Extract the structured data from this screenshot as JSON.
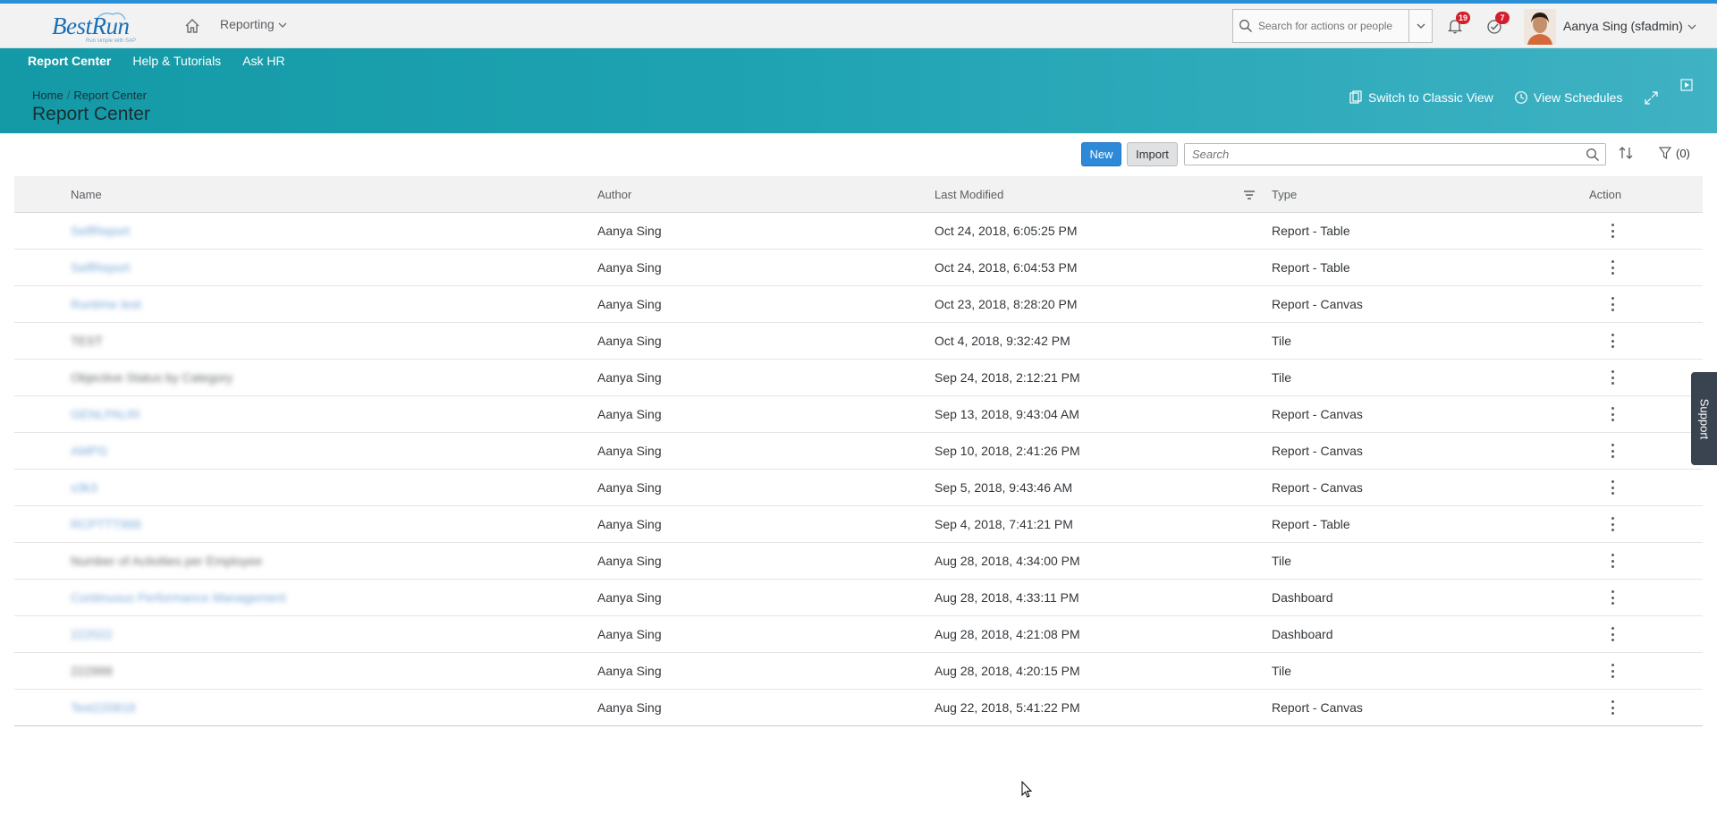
{
  "shell": {
    "logo_text": "BestRun",
    "logo_sub": "Run simple with SAP",
    "menu_label": "Reporting",
    "search_placeholder": "Search for actions or people",
    "notifications_count": "19",
    "todo_count": "7",
    "user_name": "Aanya Sing (sfadmin)"
  },
  "subnav": {
    "items": [
      {
        "label": "Report Center"
      },
      {
        "label": "Help & Tutorials"
      },
      {
        "label": "Ask HR"
      }
    ]
  },
  "breadcrumb": {
    "home": "Home",
    "current": "Report Center"
  },
  "page": {
    "title": "Report Center",
    "switch_label": "Switch to Classic View",
    "schedules_label": "View Schedules"
  },
  "toolbar": {
    "new_label": "New",
    "import_label": "Import",
    "search_placeholder": "Search",
    "filter_count": "(0)"
  },
  "table": {
    "columns": {
      "name": "Name",
      "author": "Author",
      "modified": "Last Modified",
      "type": "Type",
      "action": "Action"
    },
    "rows": [
      {
        "name": "SelfReport",
        "author": "Aanya Sing",
        "modified": "Oct 24, 2018, 6:05:25 PM",
        "type": "Report - Table"
      },
      {
        "name": "SelfReport",
        "author": "Aanya Sing",
        "modified": "Oct 24, 2018, 6:04:53 PM",
        "type": "Report - Table"
      },
      {
        "name": "Runtime test",
        "author": "Aanya Sing",
        "modified": "Oct 23, 2018, 8:28:20 PM",
        "type": "Report - Canvas"
      },
      {
        "name": "TEST",
        "author": "Aanya Sing",
        "modified": "Oct 4, 2018, 9:32:42 PM",
        "type": "Tile"
      },
      {
        "name": "Objective Status by Category",
        "author": "Aanya Sing",
        "modified": "Sep 24, 2018, 2:12:21 PM",
        "type": "Tile"
      },
      {
        "name": "GENLPALRI",
        "author": "Aanya Sing",
        "modified": "Sep 13, 2018, 9:43:04 AM",
        "type": "Report - Canvas"
      },
      {
        "name": "AMPG",
        "author": "Aanya Sing",
        "modified": "Sep 10, 2018, 2:41:26 PM",
        "type": "Report - Canvas"
      },
      {
        "name": "s3k3",
        "author": "Aanya Sing",
        "modified": "Sep 5, 2018, 9:43:46 AM",
        "type": "Report - Canvas"
      },
      {
        "name": "RCPTTT999",
        "author": "Aanya Sing",
        "modified": "Sep 4, 2018, 7:41:21 PM",
        "type": "Report - Table"
      },
      {
        "name": "Number of Activities per Employee",
        "author": "Aanya Sing",
        "modified": "Aug 28, 2018, 4:34:00 PM",
        "type": "Tile"
      },
      {
        "name": "Continuous Performance Management",
        "author": "Aanya Sing",
        "modified": "Aug 28, 2018, 4:33:11 PM",
        "type": "Dashboard"
      },
      {
        "name": "222022",
        "author": "Aanya Sing",
        "modified": "Aug 28, 2018, 4:21:08 PM",
        "type": "Dashboard"
      },
      {
        "name": "222999",
        "author": "Aanya Sing",
        "modified": "Aug 28, 2018, 4:20:15 PM",
        "type": "Tile"
      },
      {
        "name": "Test220818",
        "author": "Aanya Sing",
        "modified": "Aug 22, 2018, 5:41:22 PM",
        "type": "Report - Canvas"
      }
    ]
  },
  "support": {
    "label": "Support"
  },
  "colors": {
    "accent": "#2b8fd6",
    "hero": "#1fa3b3",
    "primary_button": "#2e8ad8",
    "badge": "#d21f2b"
  },
  "icons": [
    "home-icon",
    "chevron-down-icon",
    "search-icon",
    "bell-icon",
    "todo-check-icon",
    "classic-view-icon",
    "clock-icon",
    "fullscreen-icon",
    "play-icon",
    "sort-icon",
    "filter-icon",
    "column-filter-icon",
    "kebab-menu-icon",
    "cursor-arrow-icon"
  ]
}
